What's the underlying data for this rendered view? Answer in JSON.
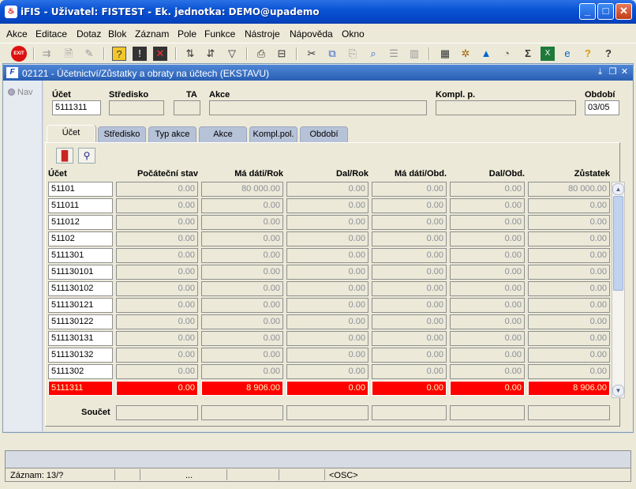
{
  "window": {
    "title": "iFIS - Uživatel: FISTEST - Ek. jednotka: DEMO@upademo",
    "minimize": "_",
    "maximize": "□",
    "close": "✕"
  },
  "menu": [
    "Akce",
    "Editace",
    "Dotaz",
    "Blok",
    "Záznam",
    "Pole",
    "Funkce",
    "Nástroje",
    "Nápověda",
    "Okno"
  ],
  "toolbar": {
    "exit_label": "EXIT",
    "icons": [
      "exit-icon",
      "insert-record-icon",
      "save-icon",
      "clear-icon",
      "query-icon",
      "enter-query-icon",
      "cancel-query-icon",
      "sort-asc-icon",
      "sort-desc-icon",
      "filter-icon",
      "print-icon",
      "print-preview-icon",
      "cut-icon",
      "copy-icon",
      "paste-icon",
      "find-icon",
      "list-icon",
      "columns-icon",
      "calculator-icon",
      "tools-icon",
      "navigator-icon",
      "clock-icon",
      "sum-icon",
      "excel-icon",
      "explorer-icon",
      "help-question-icon",
      "help-icon"
    ]
  },
  "form": {
    "title": "02121 - Účetnictví/Zůstatky a obraty na účtech (EKSTAVU)",
    "nav_label": "Nav",
    "header": {
      "ucet_label": "Účet",
      "ucet_value": "5111311",
      "stredisko_label": "Středisko",
      "stredisko_value": "",
      "ta_label": "TA",
      "ta_value": "",
      "akce_label": "Akce",
      "akce_value": "",
      "kompl_label": "Kompl. p.",
      "kompl_value": "",
      "obdobi_label": "Období",
      "obdobi_value": "03/05"
    },
    "tabs": [
      "Účet",
      "Středisko",
      "Typ akce",
      "Akce",
      "Kompl.pol.",
      "Období"
    ],
    "active_tab": "Účet",
    "columns": [
      "Účet",
      "Počáteční stav",
      "Má dáti/Rok",
      "Dal/Rok",
      "Má dáti/Obd.",
      "Dal/Obd.",
      "Zůstatek"
    ],
    "rows": [
      [
        "51101",
        "0.00",
        "80 000.00",
        "0.00",
        "0.00",
        "0.00",
        "80 000.00"
      ],
      [
        "511011",
        "0.00",
        "0.00",
        "0.00",
        "0.00",
        "0.00",
        "0.00"
      ],
      [
        "511012",
        "0.00",
        "0.00",
        "0.00",
        "0.00",
        "0.00",
        "0.00"
      ],
      [
        "51102",
        "0.00",
        "0.00",
        "0.00",
        "0.00",
        "0.00",
        "0.00"
      ],
      [
        "5111301",
        "0.00",
        "0.00",
        "0.00",
        "0.00",
        "0.00",
        "0.00"
      ],
      [
        "511130101",
        "0.00",
        "0.00",
        "0.00",
        "0.00",
        "0.00",
        "0.00"
      ],
      [
        "511130102",
        "0.00",
        "0.00",
        "0.00",
        "0.00",
        "0.00",
        "0.00"
      ],
      [
        "511130121",
        "0.00",
        "0.00",
        "0.00",
        "0.00",
        "0.00",
        "0.00"
      ],
      [
        "511130122",
        "0.00",
        "0.00",
        "0.00",
        "0.00",
        "0.00",
        "0.00"
      ],
      [
        "511130131",
        "0.00",
        "0.00",
        "0.00",
        "0.00",
        "0.00",
        "0.00"
      ],
      [
        "511130132",
        "0.00",
        "0.00",
        "0.00",
        "0.00",
        "0.00",
        "0.00"
      ],
      [
        "5111302",
        "0.00",
        "0.00",
        "0.00",
        "0.00",
        "0.00",
        "0.00"
      ],
      [
        "5111311",
        "0.00",
        "8 906.00",
        "0.00",
        "0.00",
        "0.00",
        "8 906.00"
      ]
    ],
    "selected_row": 12,
    "sum_label": "Součet",
    "sums": [
      "",
      "",
      "",
      "",
      "",
      ""
    ]
  },
  "status": {
    "record": "Záznam: 13/?",
    "seg2": "",
    "seg3": "...",
    "seg4": "",
    "mode": "<OSC>"
  },
  "colors": {
    "selected_row": "#ff0000",
    "title_blue": "#0a54d4"
  }
}
